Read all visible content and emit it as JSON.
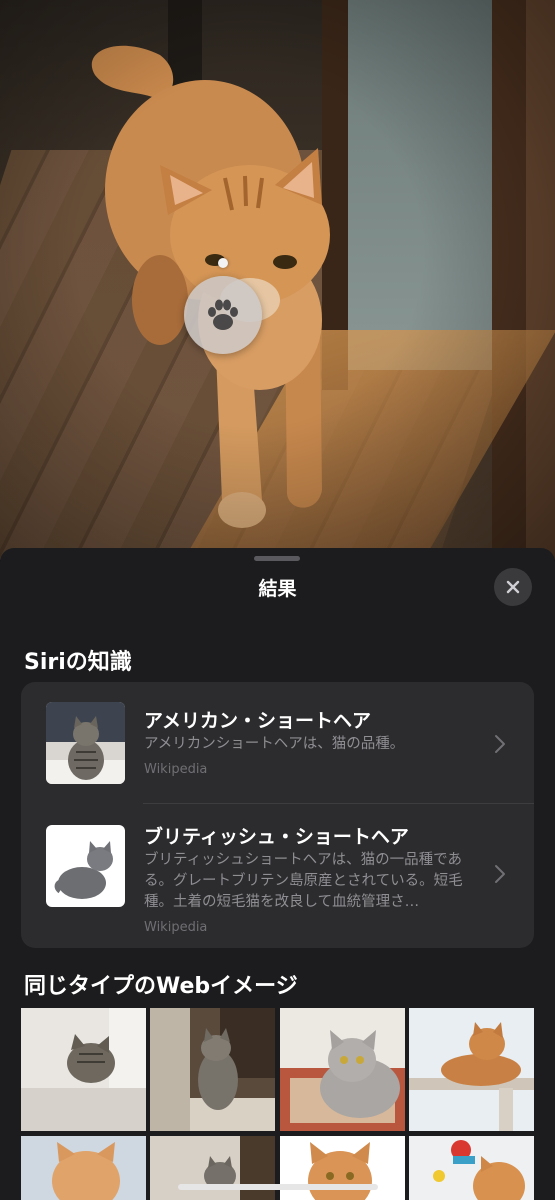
{
  "sheet": {
    "title": "結果",
    "close_label": "×"
  },
  "siri_knowledge": {
    "heading": "Siriの知識",
    "results": [
      {
        "title": "アメリカン・ショートヘア",
        "description": "アメリカンショートヘアは、猫の品種。",
        "source": "Wikipedia"
      },
      {
        "title": "ブリティッシュ・ショートヘア",
        "description": "ブリティッシュショートヘアは、猫の一品種である。グレートブリテン島原産とされている。短毛種。土着の短毛猫を改良して血統管理さ…",
        "source": "Wikipedia"
      }
    ]
  },
  "web_images": {
    "heading": "同じタイプのWebイメージ"
  },
  "colors": {
    "sheet_background": "#1c1c1e",
    "card_background": "#2c2c2e",
    "secondary_text": "#8e8e93"
  }
}
